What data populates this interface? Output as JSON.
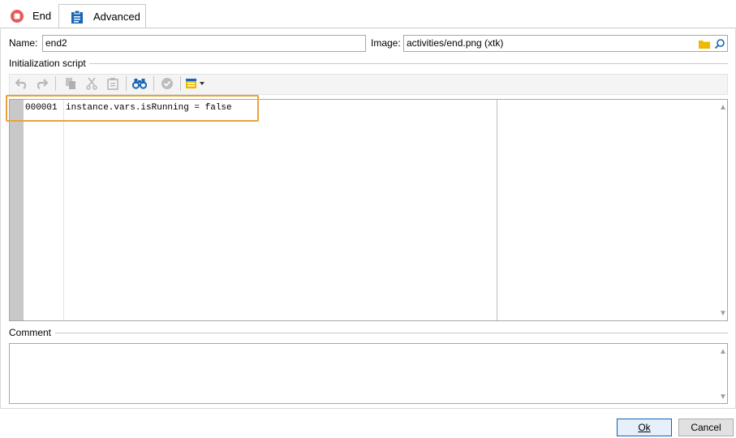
{
  "tabs": [
    {
      "label": "End",
      "icon": "stop-circle-icon"
    },
    {
      "label": "Advanced",
      "icon": "clipboard-icon"
    }
  ],
  "name": {
    "label": "Name:",
    "value": "end2"
  },
  "image": {
    "label": "Image:",
    "value": "activities/end.png (xtk)"
  },
  "init_script": {
    "label": "Initialization script",
    "line_number": "000001",
    "code": "instance.vars.isRunning = false"
  },
  "toolbar": [
    "undo-icon",
    "redo-icon",
    "copy-icon",
    "cut-icon",
    "paste-icon",
    "binoculars-icon",
    "validate-icon",
    "insert-menu-icon"
  ],
  "comment": {
    "label": "Comment",
    "value": ""
  },
  "buttons": {
    "ok_label": "Ok",
    "cancel_label": "Cancel"
  },
  "colors": {
    "accent": "#1a66b3",
    "highlight": "#e8a33c",
    "end_icon": "#e85a5a",
    "folder": "#f0b800"
  }
}
